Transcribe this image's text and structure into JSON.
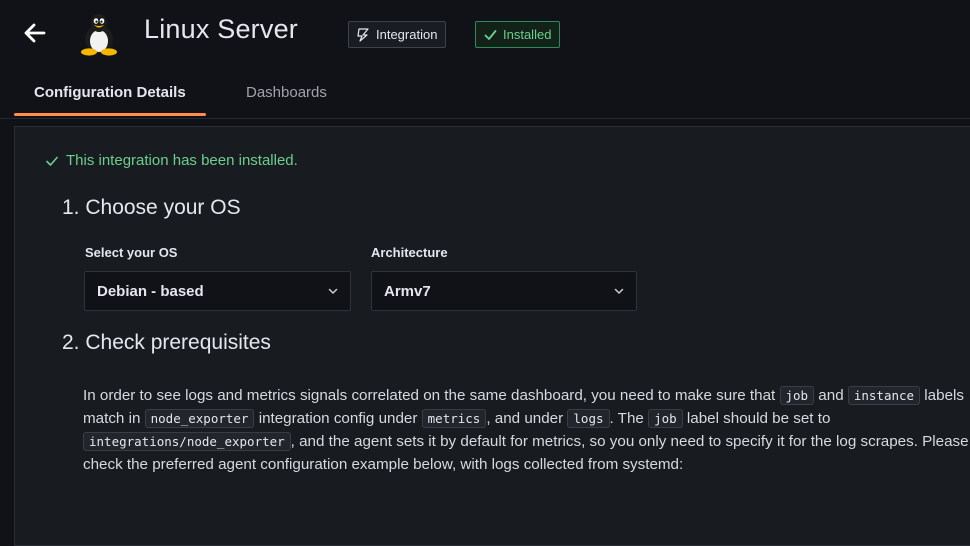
{
  "header": {
    "title": "Linux Server",
    "badges": {
      "integration": "Integration",
      "installed": "Installed"
    }
  },
  "tabs": [
    {
      "label": "Configuration Details"
    },
    {
      "label": "Dashboards"
    }
  ],
  "status": {
    "message": "This integration has been installed."
  },
  "section1": {
    "heading": "1. Choose your OS",
    "os_label": "Select your OS",
    "os_value": "Debian - based",
    "arch_label": "Architecture",
    "arch_value": "Armv7"
  },
  "section2": {
    "heading": "2. Check prerequisites"
  },
  "prereq": {
    "t1": "In order to see logs and metrics signals correlated on the same dashboard, you need to make sure that ",
    "c1": "job",
    "t2": " and ",
    "c2": "instance",
    "t3": " labels match in ",
    "c3": "node_exporter",
    "t4": " integration config under ",
    "c4": "metrics",
    "t5": ", and under ",
    "c5": "logs",
    "t6": ". The ",
    "c6": "job",
    "t7": " label should be set to ",
    "c7": "integrations/node_exporter",
    "t8": ", and the agent sets it by default for metrics, so you only need to specify it for the log scrapes. Please check the preferred agent configuration example below, with logs collected from systemd:"
  },
  "colors": {
    "accent": "#ff8c4f",
    "success": "#6ccf8e",
    "background": "#111217"
  }
}
